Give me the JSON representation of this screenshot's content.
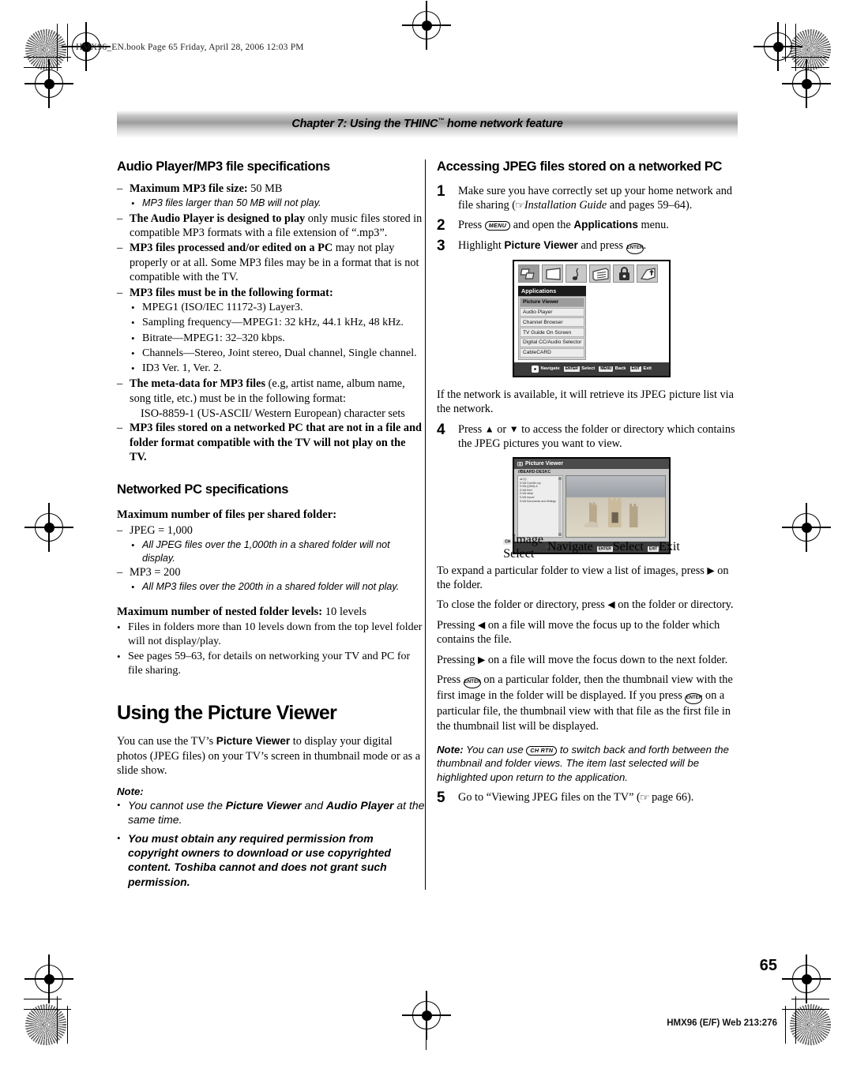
{
  "book_header": "HMX96_EN.book  Page 65  Friday, April 28, 2006  12:03 PM",
  "chapter_bar": {
    "text_before": "Chapter 7: Using the THINC",
    "tm": "™",
    "text_after": " home network feature"
  },
  "left_column": {
    "section1_title": "Audio Player/MP3 file specifications",
    "items": [
      {
        "marker": "–",
        "bold": "Maximum MP3 file size:",
        "rest": " 50 MB"
      },
      {
        "marker": "•",
        "italic": "MP3 files larger than 50 MB will not play.",
        "indent": 1
      },
      {
        "marker": "–",
        "bold": "The Audio Player is designed to play",
        "rest": " only music files stored in compatible MP3 formats with a file extension of “.mp3”."
      },
      {
        "marker": "–",
        "bold": "MP3 files processed and/or edited on a PC",
        "rest": " may not play properly or at all. Some MP3 files may be in a format that is not compatible with the TV."
      },
      {
        "marker": "–",
        "bold": "MP3 files must be in the following format:",
        "rest": ""
      },
      {
        "marker": "•",
        "plain": "MPEG1 (ISO/IEC 11172-3) Layer3.",
        "indent": 1
      },
      {
        "marker": "•",
        "plain": "Sampling frequency—MPEG1: 32 kHz, 44.1 kHz, 48 kHz.",
        "indent": 1
      },
      {
        "marker": "•",
        "plain": "Bitrate—MPEG1: 32–320 kbps.",
        "indent": 1
      },
      {
        "marker": "•",
        "plain": "Channels—Stereo, Joint stereo, Dual channel, Single channel.",
        "indent": 1
      },
      {
        "marker": "•",
        "plain": "ID3 Ver. 1, Ver. 2.",
        "indent": 1
      },
      {
        "marker": "–",
        "bold": "The meta-data for MP3 files",
        "rest": " (e.g, artist name, album name, song title, etc.) must be in the following format:"
      },
      {
        "marker": "",
        "plain": "ISO-8859-1 (US-ASCII/ Western European) character sets",
        "indent": 2
      },
      {
        "marker": "–",
        "bold": "MP3 files stored on a networked PC that are not in a file and folder format compatible with the TV will not play on the TV.",
        "rest": ""
      }
    ],
    "section2_title": "Networked PC specifications",
    "sub1_title": "Maximum number of files per shared folder:",
    "sub1_items": [
      {
        "marker": "–",
        "plain": "JPEG = 1,000"
      },
      {
        "marker": "•",
        "italic": "All JPEG files over the 1,000th in a shared folder will not display.",
        "indent": 1
      },
      {
        "marker": "–",
        "plain": "MP3 = 200"
      },
      {
        "marker": "•",
        "italic": "All MP3 files over the 200th in a shared folder will not play.",
        "indent": 1
      }
    ],
    "sub2_title_bold": "Maximum number of nested folder levels:",
    "sub2_title_rest": " 10 levels",
    "sub2_items": [
      {
        "marker": "•",
        "plain": "Files in folders more than 10 levels down from the top level folder will not display/play."
      },
      {
        "marker": "•",
        "plain": "See pages 59–63, for details on networking your TV and PC for file sharing."
      }
    ],
    "big_title": "Using the Picture Viewer",
    "intro_p1": "You can use the TV’s ",
    "intro_b1": "Picture Viewer",
    "intro_p2": " to display your digital photos (JPEG files) on your TV’s screen in thumbnail mode or as a slide show.",
    "note_label": "Note:",
    "note_items": [
      {
        "pre": "You cannot use the ",
        "b1": "Picture Viewer",
        "mid": " and ",
        "b2": "Audio Player",
        "post": " at the same time."
      },
      {
        "allbold": "You must obtain any required permission from copyright owners to download or use copyrighted content. Toshiba cannot and does not grant such permission."
      }
    ]
  },
  "right_column": {
    "section_title": "Accessing JPEG files stored on a networked PC",
    "steps": [
      {
        "n": "1",
        "pre": "Make sure you have correctly set up your home network and file sharing (",
        "hand": "☞",
        "ital": "Installation Guide",
        "post": " and pages 59–64)."
      },
      {
        "n": "2",
        "pre": "Press ",
        "key": "MENU",
        "post": " and open the ",
        "bold": "Applications",
        "tail": " menu."
      },
      {
        "n": "3",
        "pre": "Highlight ",
        "bold": "Picture Viewer",
        "mid": " and press ",
        "key": "ENTER",
        "tail": "."
      }
    ],
    "after_shot1": "If the network is available, it will retrieve its JPEG picture list via the network.",
    "step4": {
      "n": "4",
      "pre": "Press ",
      "up": "▲",
      "mid": " or ",
      "down": "▼",
      "post": " to access the folder or directory which contains the JPEG pictures you want to view."
    },
    "after_shot2": [
      {
        "pre": "To expand a particular folder to view a list of images, press ",
        "arrow": "▶",
        "post": " on the folder."
      },
      {
        "pre": "To close the folder or directory, press ",
        "arrow": "◀",
        "post": " on the folder or directory."
      },
      {
        "pre": "Pressing ",
        "arrow": "◀",
        "post": " on a file will move the focus up to the folder which contains the file."
      },
      {
        "pre": "Pressing ",
        "arrow": "▶",
        "post": " on a file will move the focus down to the next folder."
      }
    ],
    "enter_para": {
      "pre": "Press ",
      "key1": "ENTER",
      "mid": " on a particular folder, then the thumbnail view with the first image in the folder will be displayed. If you press ",
      "key2": "ENTER",
      "post": " on a particular file, the thumbnail view with that file as the first file in the thumbnail list will be displayed."
    },
    "note": {
      "label": "Note:",
      "pre": " You can use ",
      "key": "CH RTN",
      "post": " to switch back and forth between the thumbnail and folder views. The item last selected will be highlighted upon return to the application."
    },
    "step5": {
      "n": "5",
      "pre": "Go to “Viewing JPEG files on the TV” (",
      "hand": "☞",
      "post": " page 66)."
    }
  },
  "tv_menu_screen": {
    "icons": [
      "applications-icon",
      "picture-icon",
      "audio-icon",
      "preferences-icon",
      "lock-icon",
      "setup-icon"
    ],
    "menu_title": "Applications",
    "items": [
      "Picture Viewer",
      "Audio Player",
      "Channel Browser",
      "TV Guide On Screen",
      "Digital CC/Audio Selector",
      "CableCARD"
    ],
    "selected": "Picture Viewer",
    "bottom_bar": [
      {
        "key": "",
        "glyph": "dpad",
        "label": "Navigate"
      },
      {
        "key": "ENTER",
        "label": "Select"
      },
      {
        "key": "MENU",
        "label": "Back"
      },
      {
        "key": "EXIT",
        "label": "Exit"
      }
    ]
  },
  "tv_viewer_screen": {
    "title": "Picture Viewer",
    "path": "//BEARD-DESKC",
    "tree": [
      "all (2)",
      "D:\\All Core\\thi-mp",
      "D:\\All (QHM)-A",
      "D:\\All thml",
      "D:\\All sleep",
      "D:\\All repos/",
      "D:\\All Documents and Settings"
    ],
    "bottom_bar": [
      {
        "key": "CH",
        "label": "Image Select"
      },
      {
        "key": "",
        "glyph": "dpad",
        "label": "Navigate"
      },
      {
        "key": "ENTER",
        "label": "Select"
      },
      {
        "key": "EXIT",
        "label": "Exit"
      }
    ]
  },
  "page_number": "65",
  "footer": "HMX96 (E/F) Web 213:276"
}
